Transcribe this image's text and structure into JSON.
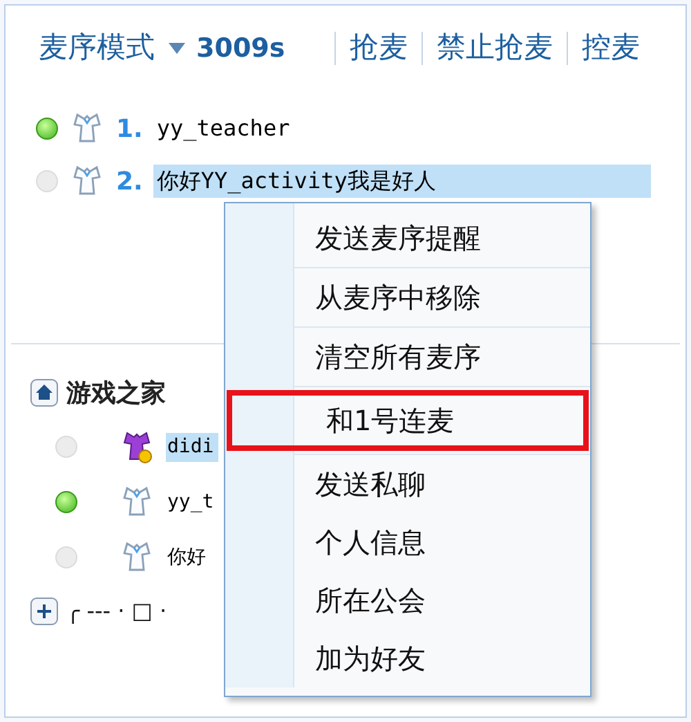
{
  "toolbar": {
    "mode": "麦序模式",
    "timer": "3009s",
    "actions": [
      "抢麦",
      "禁止抢麦",
      "控麦"
    ]
  },
  "queue": [
    {
      "number": "1.",
      "name": "yy_teacher",
      "online": true,
      "selected": false
    },
    {
      "number": "2.",
      "name": "你好YY_activity我是好人",
      "online": false,
      "selected": true
    }
  ],
  "channel": {
    "name": "游戏之家",
    "users": [
      {
        "name": "didi",
        "online": false,
        "selected": true,
        "kind": "admin"
      },
      {
        "name": "yy_t",
        "online": true,
        "selected": false,
        "kind": "member"
      },
      {
        "name": "你好",
        "online": false,
        "selected": false,
        "kind": "member"
      }
    ]
  },
  "subchannel": {
    "name": "╭ --- · □ ·"
  },
  "context_menu": [
    {
      "label": "发送麦序提醒",
      "separator_after": true,
      "highlighted": false
    },
    {
      "label": "从麦序中移除",
      "separator_after": true,
      "highlighted": false
    },
    {
      "label": "清空所有麦序",
      "separator_after": true,
      "highlighted": false
    },
    {
      "label": "和1号连麦",
      "separator_after": true,
      "highlighted": true
    },
    {
      "label": "发送私聊",
      "separator_after": false,
      "highlighted": false
    },
    {
      "label": "个人信息",
      "separator_after": false,
      "highlighted": false
    },
    {
      "label": "所在公会",
      "separator_after": false,
      "highlighted": false
    },
    {
      "label": "加为好友",
      "separator_after": false,
      "highlighted": false
    }
  ]
}
